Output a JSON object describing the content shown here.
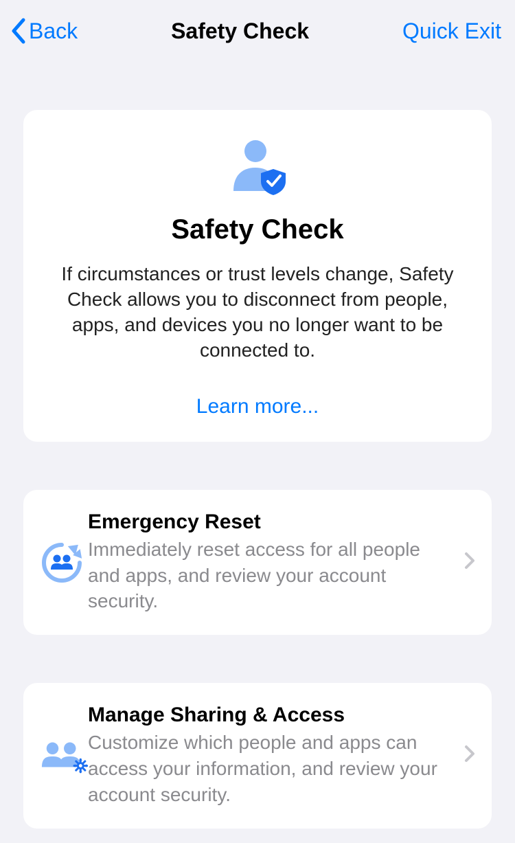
{
  "nav": {
    "back_label": "Back",
    "title": "Safety Check",
    "quick_exit_label": "Quick Exit"
  },
  "intro": {
    "title": "Safety Check",
    "description": "If circumstances or trust levels change, Safety Check allows you to disconnect from people, apps, and devices you no longer want to be connected to.",
    "learn_more_label": "Learn more..."
  },
  "options": [
    {
      "title": "Emergency Reset",
      "description": "Immediately reset access for all people and apps, and review your account security."
    },
    {
      "title": "Manage Sharing & Access",
      "description": "Customize which people and apps can access your information, and review your account security."
    }
  ]
}
